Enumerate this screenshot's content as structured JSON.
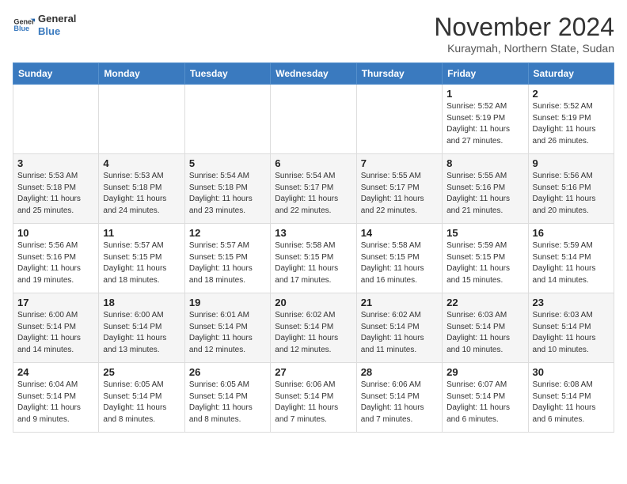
{
  "logo": {
    "line1": "General",
    "line2": "Blue"
  },
  "title": "November 2024",
  "subtitle": "Kuraymah, Northern State, Sudan",
  "weekdays": [
    "Sunday",
    "Monday",
    "Tuesday",
    "Wednesday",
    "Thursday",
    "Friday",
    "Saturday"
  ],
  "weeks": [
    [
      {
        "day": "",
        "info": ""
      },
      {
        "day": "",
        "info": ""
      },
      {
        "day": "",
        "info": ""
      },
      {
        "day": "",
        "info": ""
      },
      {
        "day": "",
        "info": ""
      },
      {
        "day": "1",
        "info": "Sunrise: 5:52 AM\nSunset: 5:19 PM\nDaylight: 11 hours\nand 27 minutes."
      },
      {
        "day": "2",
        "info": "Sunrise: 5:52 AM\nSunset: 5:19 PM\nDaylight: 11 hours\nand 26 minutes."
      }
    ],
    [
      {
        "day": "3",
        "info": "Sunrise: 5:53 AM\nSunset: 5:18 PM\nDaylight: 11 hours\nand 25 minutes."
      },
      {
        "day": "4",
        "info": "Sunrise: 5:53 AM\nSunset: 5:18 PM\nDaylight: 11 hours\nand 24 minutes."
      },
      {
        "day": "5",
        "info": "Sunrise: 5:54 AM\nSunset: 5:18 PM\nDaylight: 11 hours\nand 23 minutes."
      },
      {
        "day": "6",
        "info": "Sunrise: 5:54 AM\nSunset: 5:17 PM\nDaylight: 11 hours\nand 22 minutes."
      },
      {
        "day": "7",
        "info": "Sunrise: 5:55 AM\nSunset: 5:17 PM\nDaylight: 11 hours\nand 22 minutes."
      },
      {
        "day": "8",
        "info": "Sunrise: 5:55 AM\nSunset: 5:16 PM\nDaylight: 11 hours\nand 21 minutes."
      },
      {
        "day": "9",
        "info": "Sunrise: 5:56 AM\nSunset: 5:16 PM\nDaylight: 11 hours\nand 20 minutes."
      }
    ],
    [
      {
        "day": "10",
        "info": "Sunrise: 5:56 AM\nSunset: 5:16 PM\nDaylight: 11 hours\nand 19 minutes."
      },
      {
        "day": "11",
        "info": "Sunrise: 5:57 AM\nSunset: 5:15 PM\nDaylight: 11 hours\nand 18 minutes."
      },
      {
        "day": "12",
        "info": "Sunrise: 5:57 AM\nSunset: 5:15 PM\nDaylight: 11 hours\nand 18 minutes."
      },
      {
        "day": "13",
        "info": "Sunrise: 5:58 AM\nSunset: 5:15 PM\nDaylight: 11 hours\nand 17 minutes."
      },
      {
        "day": "14",
        "info": "Sunrise: 5:58 AM\nSunset: 5:15 PM\nDaylight: 11 hours\nand 16 minutes."
      },
      {
        "day": "15",
        "info": "Sunrise: 5:59 AM\nSunset: 5:15 PM\nDaylight: 11 hours\nand 15 minutes."
      },
      {
        "day": "16",
        "info": "Sunrise: 5:59 AM\nSunset: 5:14 PM\nDaylight: 11 hours\nand 14 minutes."
      }
    ],
    [
      {
        "day": "17",
        "info": "Sunrise: 6:00 AM\nSunset: 5:14 PM\nDaylight: 11 hours\nand 14 minutes."
      },
      {
        "day": "18",
        "info": "Sunrise: 6:00 AM\nSunset: 5:14 PM\nDaylight: 11 hours\nand 13 minutes."
      },
      {
        "day": "19",
        "info": "Sunrise: 6:01 AM\nSunset: 5:14 PM\nDaylight: 11 hours\nand 12 minutes."
      },
      {
        "day": "20",
        "info": "Sunrise: 6:02 AM\nSunset: 5:14 PM\nDaylight: 11 hours\nand 12 minutes."
      },
      {
        "day": "21",
        "info": "Sunrise: 6:02 AM\nSunset: 5:14 PM\nDaylight: 11 hours\nand 11 minutes."
      },
      {
        "day": "22",
        "info": "Sunrise: 6:03 AM\nSunset: 5:14 PM\nDaylight: 11 hours\nand 10 minutes."
      },
      {
        "day": "23",
        "info": "Sunrise: 6:03 AM\nSunset: 5:14 PM\nDaylight: 11 hours\nand 10 minutes."
      }
    ],
    [
      {
        "day": "24",
        "info": "Sunrise: 6:04 AM\nSunset: 5:14 PM\nDaylight: 11 hours\nand 9 minutes."
      },
      {
        "day": "25",
        "info": "Sunrise: 6:05 AM\nSunset: 5:14 PM\nDaylight: 11 hours\nand 8 minutes."
      },
      {
        "day": "26",
        "info": "Sunrise: 6:05 AM\nSunset: 5:14 PM\nDaylight: 11 hours\nand 8 minutes."
      },
      {
        "day": "27",
        "info": "Sunrise: 6:06 AM\nSunset: 5:14 PM\nDaylight: 11 hours\nand 7 minutes."
      },
      {
        "day": "28",
        "info": "Sunrise: 6:06 AM\nSunset: 5:14 PM\nDaylight: 11 hours\nand 7 minutes."
      },
      {
        "day": "29",
        "info": "Sunrise: 6:07 AM\nSunset: 5:14 PM\nDaylight: 11 hours\nand 6 minutes."
      },
      {
        "day": "30",
        "info": "Sunrise: 6:08 AM\nSunset: 5:14 PM\nDaylight: 11 hours\nand 6 minutes."
      }
    ]
  ]
}
